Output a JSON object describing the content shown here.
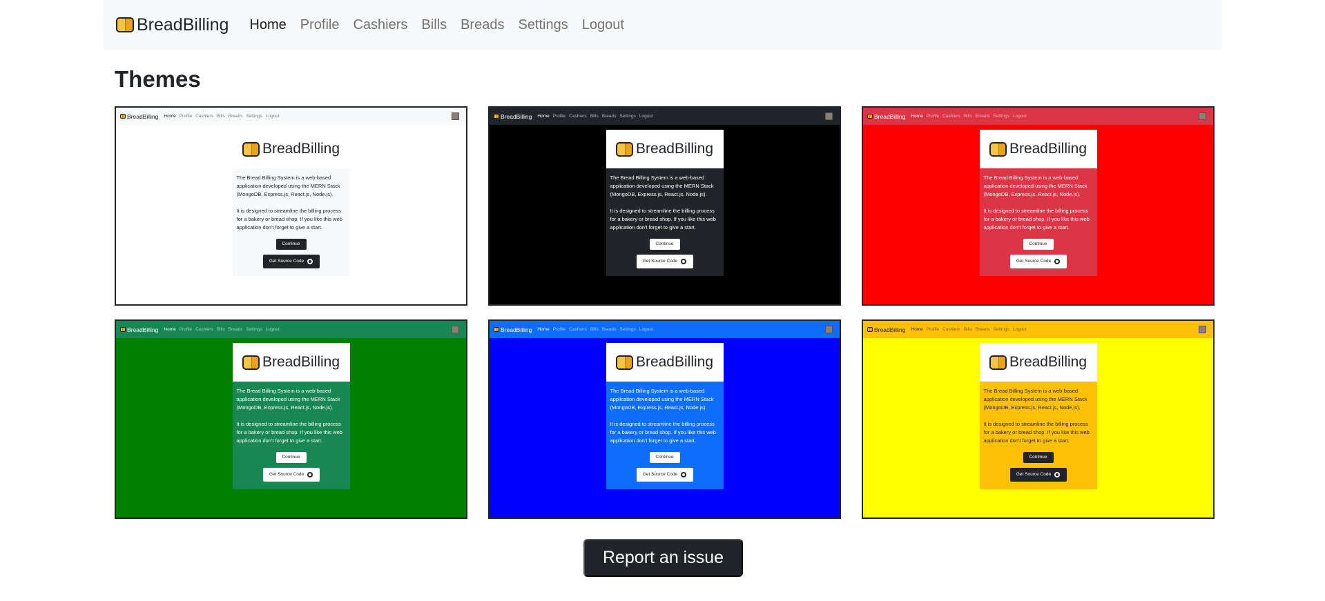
{
  "brand": {
    "name": "BreadBilling"
  },
  "nav": {
    "items": [
      {
        "label": "Home",
        "active": true
      },
      {
        "label": "Profile"
      },
      {
        "label": "Cashiers"
      },
      {
        "label": "Bills"
      },
      {
        "label": "Breads"
      },
      {
        "label": "Settings"
      },
      {
        "label": "Logout"
      }
    ]
  },
  "page": {
    "title": "Themes"
  },
  "preview": {
    "paragraph1": "The Bread Billing System is a web-based application developed using the MERN Stack (MongoDB, Express.js, React.js, Node.js).",
    "paragraph2": "It is designed to streamline the billing process for a bakery or bread shop. If you like this web application don't forget to give a start.",
    "continue_label": "Continue",
    "source_label": "Get Source Code",
    "icon": "github-icon"
  },
  "themes": [
    {
      "name": "light",
      "colors": {
        "bg": "#ffffff",
        "nav": "#f8f9fa",
        "navText": "#212529",
        "panel": "#f8f9fa",
        "text": "#212529",
        "btnBg": "#212529",
        "btnText": "#ffffff"
      }
    },
    {
      "name": "dark",
      "colors": {
        "bg": "#000000",
        "nav": "#212529",
        "navText": "#ffffff",
        "panel": "#212529",
        "text": "#ffffff",
        "btnBg": "#ffffff",
        "btnText": "#212529"
      }
    },
    {
      "name": "red",
      "colors": {
        "bg": "#ff0000",
        "nav": "#dc3545",
        "navText": "#ffffff",
        "panel": "#dc3545",
        "text": "#ffffff",
        "btnBg": "#ffffff",
        "btnText": "#212529"
      }
    },
    {
      "name": "green",
      "colors": {
        "bg": "#008000",
        "nav": "#198754",
        "navText": "#ffffff",
        "panel": "#198754",
        "text": "#ffffff",
        "btnBg": "#ffffff",
        "btnText": "#212529"
      }
    },
    {
      "name": "blue",
      "colors": {
        "bg": "#0000ff",
        "nav": "#0d6efd",
        "navText": "#ffffff",
        "panel": "#0d6efd",
        "text": "#ffffff",
        "btnBg": "#ffffff",
        "btnText": "#212529"
      }
    },
    {
      "name": "yellow",
      "colors": {
        "bg": "#ffff00",
        "nav": "#ffc107",
        "navText": "#212529",
        "panel": "#ffc107",
        "text": "#212529",
        "btnBg": "#212529",
        "btnText": "#ffffff"
      }
    }
  ],
  "footer": {
    "report_label": "Report an issue"
  }
}
